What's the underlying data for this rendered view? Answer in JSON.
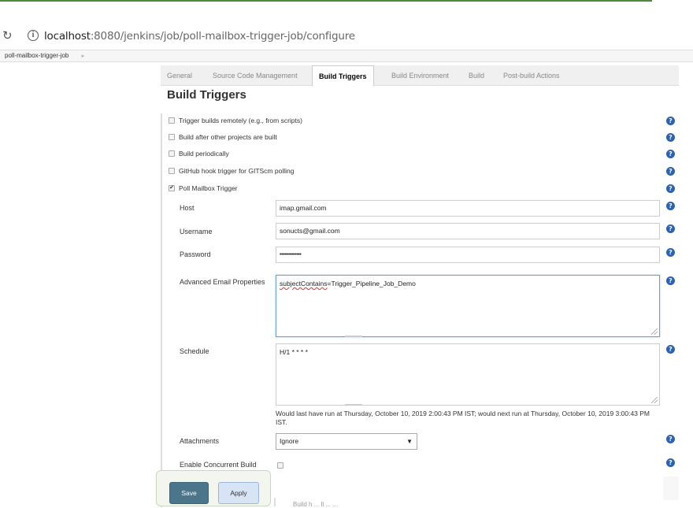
{
  "browser": {
    "url_host": "localhost",
    "url_rest": ":8080/jenkins/job/poll-mailbox-trigger-job/configure"
  },
  "breadcrumb": {
    "job": "poll-mailbox-trigger-job"
  },
  "tabs": [
    "General",
    "Source Code Management",
    "Build Triggers",
    "Build Environment",
    "Build",
    "Post-build Actions"
  ],
  "active_tab": "Build Triggers",
  "section_title": "Build Triggers",
  "triggers": [
    {
      "label": "Trigger builds remotely (e.g., from scripts)",
      "checked": false
    },
    {
      "label": "Build after other projects are built",
      "checked": false
    },
    {
      "label": "Build periodically",
      "checked": false
    },
    {
      "label": "GitHub hook trigger for GITScm polling",
      "checked": false
    },
    {
      "label": "Poll Mailbox Trigger",
      "checked": true
    }
  ],
  "poll": {
    "host_label": "Host",
    "host_value": "imap.gmail.com",
    "username_label": "Username",
    "username_value": "sonucts@gmail.com",
    "password_label": "Password",
    "password_value": "••••••••••••••",
    "adv_label": "Advanced Email Properties",
    "adv_key": "subjectContains",
    "adv_rest": "=Trigger_Pipeline_Job_Demo",
    "schedule_label": "Schedule",
    "schedule_value": "H/1 * * * *",
    "schedule_note": "Would last have run at Thursday, October 10, 2019 2:00:43 PM IST; would next run at Thursday, October 10, 2019 3:00:43 PM IST.",
    "attachments_label": "Attachments",
    "attachments_value": "Ignore",
    "concurrent_label": "Enable Concurrent Build"
  },
  "buttons": {
    "save": "Save",
    "apply": "Apply"
  },
  "faded_text": "de",
  "faded_text2": "Build  h  ...  ll  ...  ..."
}
